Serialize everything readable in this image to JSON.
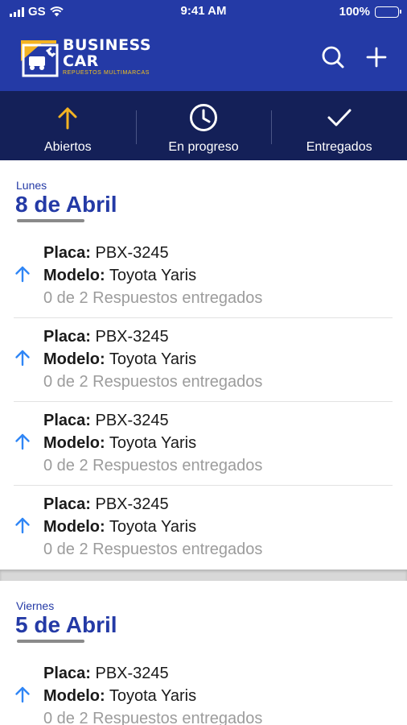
{
  "status_bar": {
    "carrier": "GS",
    "time": "9:41 AM",
    "battery": "100%"
  },
  "header": {
    "logo_line1": "BUSINESS",
    "logo_line2": "CAR",
    "logo_sub": "REPUESTOS MULTIMARCAS",
    "search_icon": "search-icon",
    "add_icon": "plus-icon"
  },
  "tabs": [
    {
      "label": "Abiertos",
      "icon": "arrow-up-icon"
    },
    {
      "label": "En progreso",
      "icon": "clock-icon"
    },
    {
      "label": "Entregados",
      "icon": "check-icon"
    }
  ],
  "colors": {
    "primary": "#243aa6",
    "tabbar": "#142058",
    "accent": "#f4b322",
    "arrow_blue": "#2f86f6"
  },
  "sections": [
    {
      "day": "Lunes",
      "date": "8 de Abril",
      "orders": [
        {
          "placa_label": "Placa:",
          "placa": "PBX-3245",
          "modelo_label": "Modelo:",
          "modelo": "Toyota Yaris",
          "status": "0 de 2 Respuestos entregados"
        },
        {
          "placa_label": "Placa:",
          "placa": "PBX-3245",
          "modelo_label": "Modelo:",
          "modelo": "Toyota Yaris",
          "status": "0 de 2 Respuestos entregados"
        },
        {
          "placa_label": "Placa:",
          "placa": "PBX-3245",
          "modelo_label": "Modelo:",
          "modelo": "Toyota Yaris",
          "status": "0 de 2 Respuestos entregados"
        },
        {
          "placa_label": "Placa:",
          "placa": "PBX-3245",
          "modelo_label": "Modelo:",
          "modelo": "Toyota Yaris",
          "status": "0 de 2 Respuestos entregados"
        }
      ]
    },
    {
      "day": "Viernes",
      "date": "5 de Abril",
      "orders": [
        {
          "placa_label": "Placa:",
          "placa": "PBX-3245",
          "modelo_label": "Modelo:",
          "modelo": "Toyota Yaris",
          "status": "0 de 2 Respuestos entregados"
        }
      ]
    }
  ]
}
